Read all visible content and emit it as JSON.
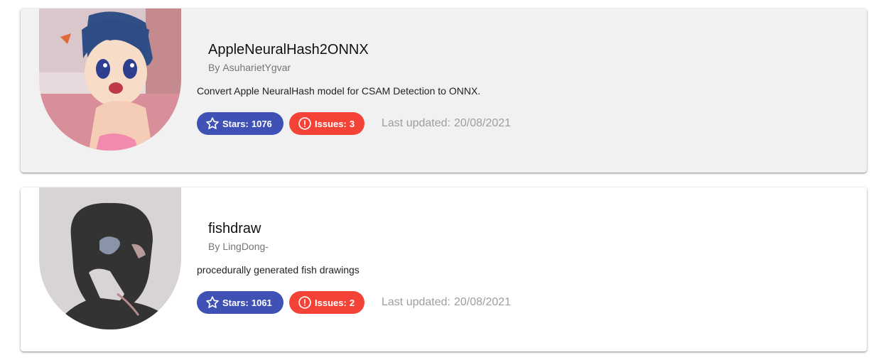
{
  "repos": [
    {
      "name": "AppleNeuralHash2ONNX",
      "owner_prefix": "By",
      "owner": "AsuharietYgvar",
      "description": "Convert Apple NeuralHash model for CSAM Detection to ONNX.",
      "stars_label": "Stars:",
      "stars": "1076",
      "issues_label": "Issues:",
      "issues": "3",
      "updated_label": "Last updated:",
      "updated": "20/08/2021",
      "avatar": "anime-girl-avatar",
      "card_bg": "#f1f1f1"
    },
    {
      "name": "fishdraw",
      "owner_prefix": "By",
      "owner": "LingDong-",
      "description": "procedurally generated fish drawings",
      "stars_label": "Stars:",
      "stars": "1061",
      "issues_label": "Issues:",
      "issues": "2",
      "updated_label": "Last updated:",
      "updated": "20/08/2021",
      "avatar": "silhouette-avatar",
      "card_bg": "#ffffff"
    }
  ],
  "colors": {
    "stars_badge": "#3f51b5",
    "issues_badge": "#f44336",
    "muted_text": "#9e9e9e"
  },
  "icons": {
    "stars": "star-outline-icon",
    "issues": "exclamation-circle-icon"
  }
}
